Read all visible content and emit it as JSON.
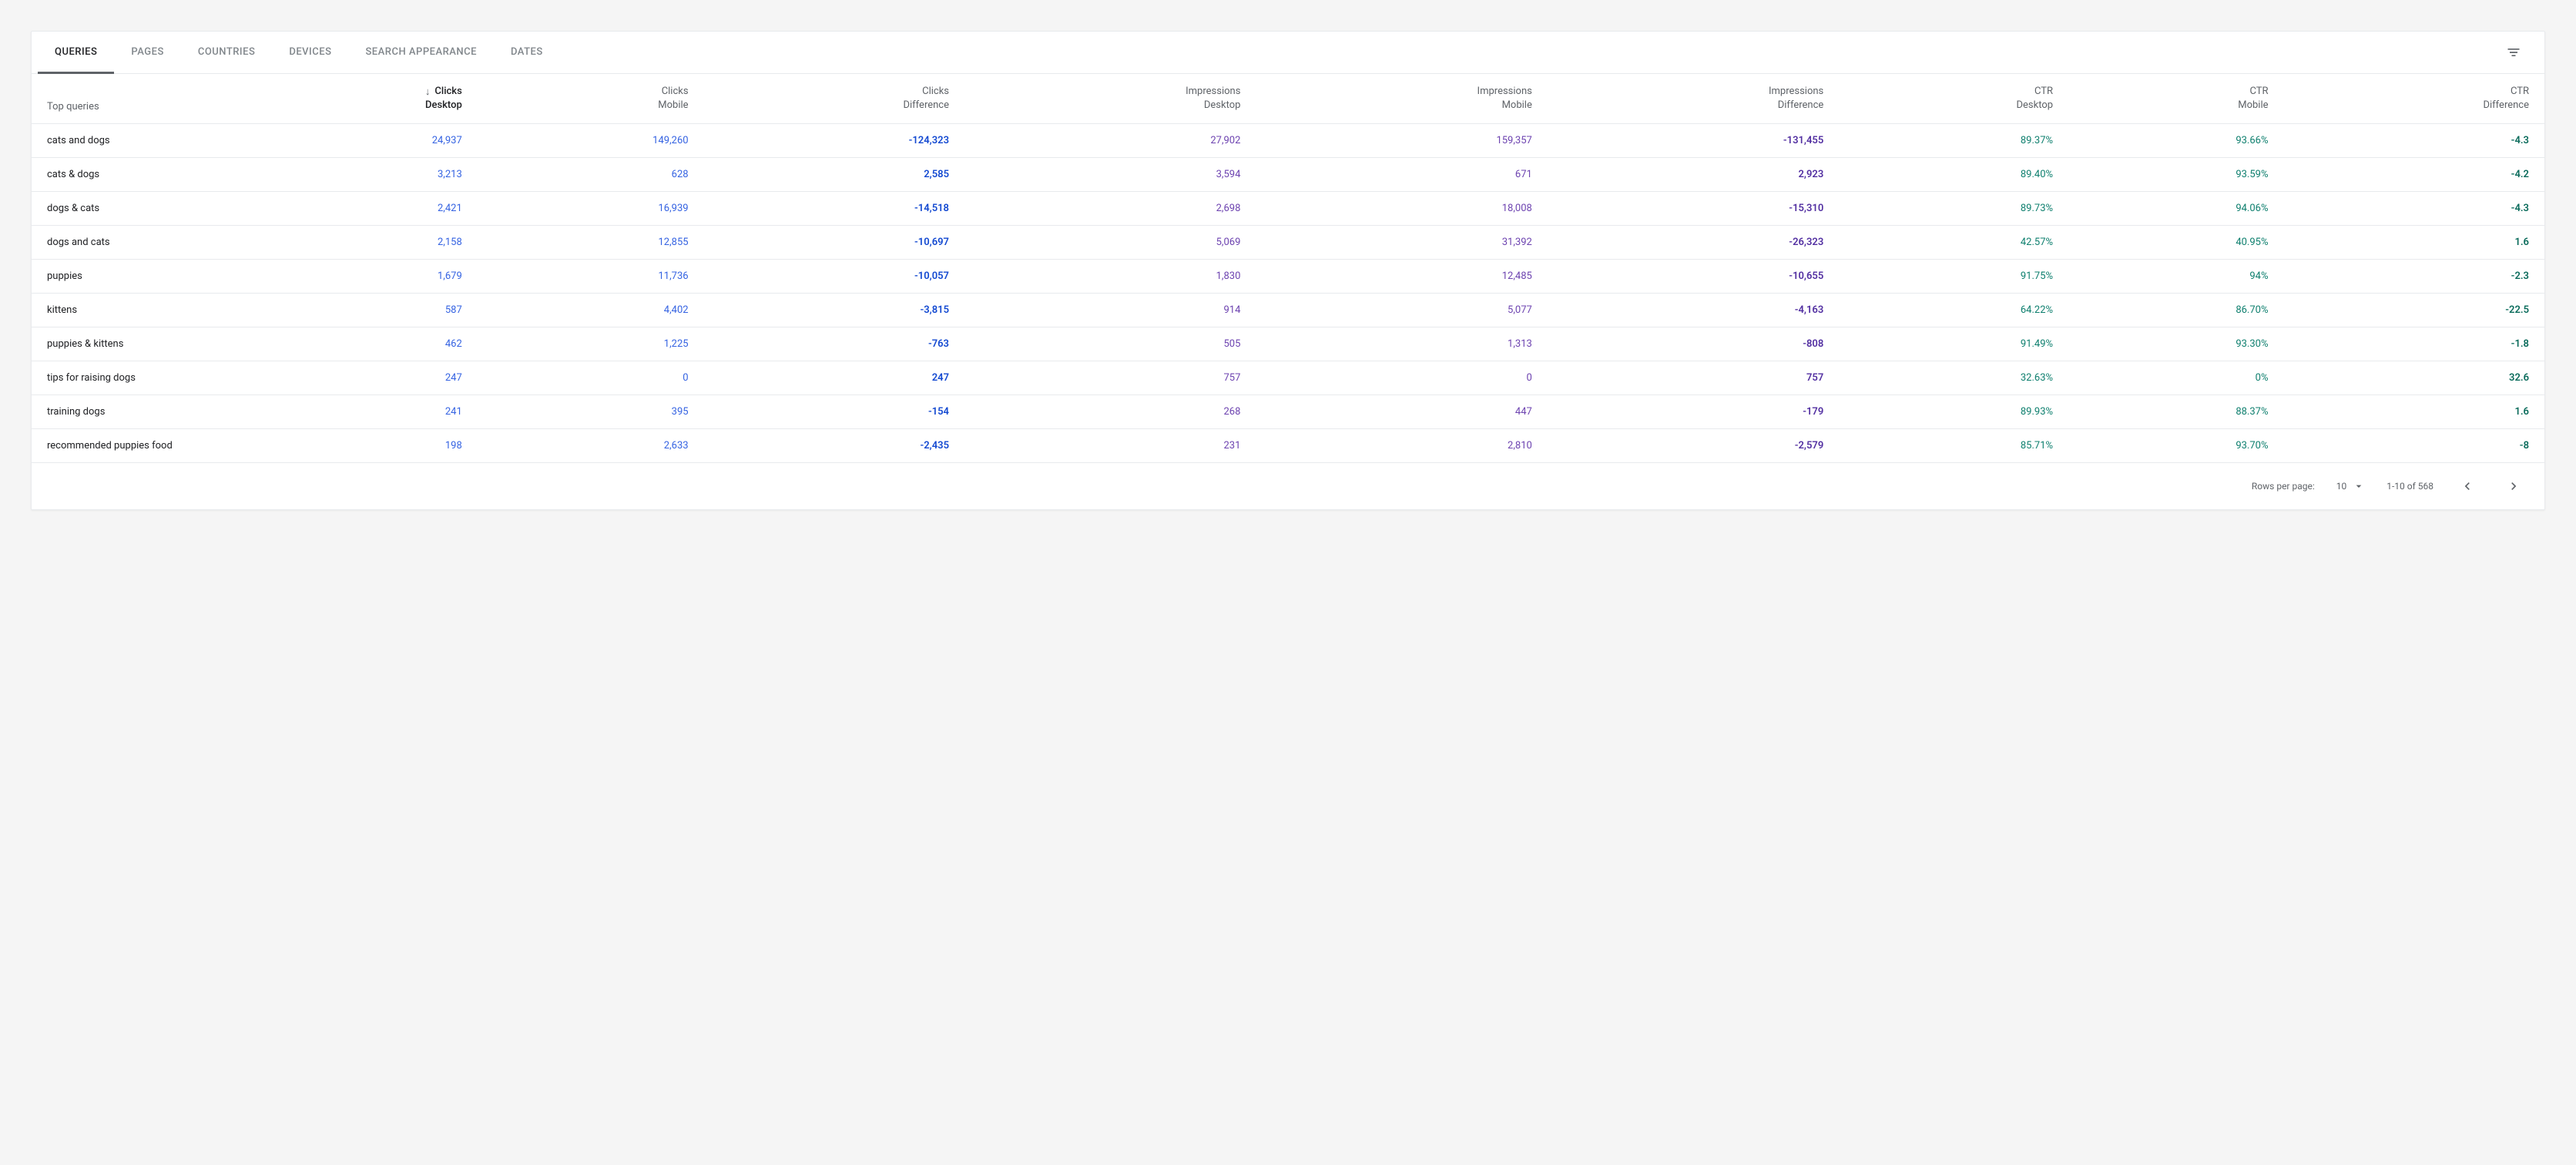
{
  "tabs": [
    {
      "label": "Queries",
      "active": true
    },
    {
      "label": "Pages",
      "active": false
    },
    {
      "label": "Countries",
      "active": false
    },
    {
      "label": "Devices",
      "active": false
    },
    {
      "label": "Search Appearance",
      "active": false
    },
    {
      "label": "Dates",
      "active": false
    }
  ],
  "columns": {
    "query": "Top queries",
    "clicks_desktop": {
      "l1": "Clicks",
      "l2": "Desktop"
    },
    "clicks_mobile": {
      "l1": "Clicks",
      "l2": "Mobile"
    },
    "clicks_diff": {
      "l1": "Clicks",
      "l2": "Difference"
    },
    "impr_desktop": {
      "l1": "Impressions",
      "l2": "Desktop"
    },
    "impr_mobile": {
      "l1": "Impressions",
      "l2": "Mobile"
    },
    "impr_diff": {
      "l1": "Impressions",
      "l2": "Difference"
    },
    "ctr_desktop": {
      "l1": "CTR",
      "l2": "Desktop"
    },
    "ctr_mobile": {
      "l1": "CTR",
      "l2": "Mobile"
    },
    "ctr_diff": {
      "l1": "CTR",
      "l2": "Difference"
    }
  },
  "rows": [
    {
      "query": "cats and dogs",
      "clicks_desktop": "24,937",
      "clicks_mobile": "149,260",
      "clicks_diff": "-124,323",
      "impr_desktop": "27,902",
      "impr_mobile": "159,357",
      "impr_diff": "-131,455",
      "ctr_desktop": "89.37%",
      "ctr_mobile": "93.66%",
      "ctr_diff": "-4.3"
    },
    {
      "query": "cats & dogs",
      "clicks_desktop": "3,213",
      "clicks_mobile": "628",
      "clicks_diff": "2,585",
      "impr_desktop": "3,594",
      "impr_mobile": "671",
      "impr_diff": "2,923",
      "ctr_desktop": "89.40%",
      "ctr_mobile": "93.59%",
      "ctr_diff": "-4.2"
    },
    {
      "query": "dogs & cats",
      "clicks_desktop": "2,421",
      "clicks_mobile": "16,939",
      "clicks_diff": "-14,518",
      "impr_desktop": "2,698",
      "impr_mobile": "18,008",
      "impr_diff": "-15,310",
      "ctr_desktop": "89.73%",
      "ctr_mobile": "94.06%",
      "ctr_diff": "-4.3"
    },
    {
      "query": "dogs and cats",
      "clicks_desktop": "2,158",
      "clicks_mobile": "12,855",
      "clicks_diff": "-10,697",
      "impr_desktop": "5,069",
      "impr_mobile": "31,392",
      "impr_diff": "-26,323",
      "ctr_desktop": "42.57%",
      "ctr_mobile": "40.95%",
      "ctr_diff": "1.6"
    },
    {
      "query": "puppies",
      "clicks_desktop": "1,679",
      "clicks_mobile": "11,736",
      "clicks_diff": "-10,057",
      "impr_desktop": "1,830",
      "impr_mobile": "12,485",
      "impr_diff": "-10,655",
      "ctr_desktop": "91.75%",
      "ctr_mobile": "94%",
      "ctr_diff": "-2.3"
    },
    {
      "query": "kittens",
      "clicks_desktop": "587",
      "clicks_mobile": "4,402",
      "clicks_diff": "-3,815",
      "impr_desktop": "914",
      "impr_mobile": "5,077",
      "impr_diff": "-4,163",
      "ctr_desktop": "64.22%",
      "ctr_mobile": "86.70%",
      "ctr_diff": "-22.5"
    },
    {
      "query": "puppies & kittens",
      "clicks_desktop": "462",
      "clicks_mobile": "1,225",
      "clicks_diff": "-763",
      "impr_desktop": "505",
      "impr_mobile": "1,313",
      "impr_diff": "-808",
      "ctr_desktop": "91.49%",
      "ctr_mobile": "93.30%",
      "ctr_diff": "-1.8"
    },
    {
      "query": "tips for raising dogs",
      "clicks_desktop": "247",
      "clicks_mobile": "0",
      "clicks_diff": "247",
      "impr_desktop": "757",
      "impr_mobile": "0",
      "impr_diff": "757",
      "ctr_desktop": "32.63%",
      "ctr_mobile": "0%",
      "ctr_diff": "32.6"
    },
    {
      "query": "training dogs",
      "clicks_desktop": "241",
      "clicks_mobile": "395",
      "clicks_diff": "-154",
      "impr_desktop": "268",
      "impr_mobile": "447",
      "impr_diff": "-179",
      "ctr_desktop": "89.93%",
      "ctr_mobile": "88.37%",
      "ctr_diff": "1.6"
    },
    {
      "query": "recommended puppies food",
      "clicks_desktop": "198",
      "clicks_mobile": "2,633",
      "clicks_diff": "-2,435",
      "impr_desktop": "231",
      "impr_mobile": "2,810",
      "impr_diff": "-2,579",
      "ctr_desktop": "85.71%",
      "ctr_mobile": "93.70%",
      "ctr_diff": "-8"
    }
  ],
  "footer": {
    "rows_label": "Rows per page:",
    "rows_value": "10",
    "range": "1-10 of 568"
  }
}
